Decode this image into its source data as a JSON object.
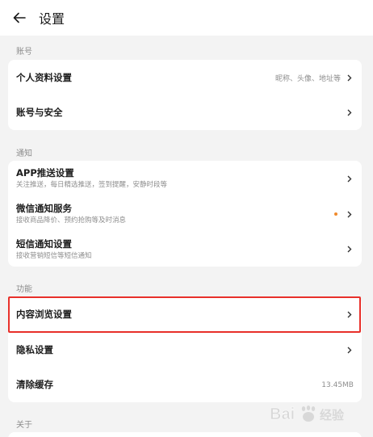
{
  "header": {
    "title": "设置"
  },
  "sections": {
    "account": {
      "label": "账号",
      "rows": [
        {
          "title": "个人资料设置",
          "hint": "昵称、头像、地址等"
        },
        {
          "title": "账号与安全"
        }
      ]
    },
    "notify": {
      "label": "通知",
      "rows": [
        {
          "title": "APP推送设置",
          "sub": "关注推送，每日精选推送，签到提醒，安静时段等"
        },
        {
          "title": "微信通知服务",
          "sub": "接收商品降价、预约抢购等及时消息"
        },
        {
          "title": "短信通知设置",
          "sub": "接收营销短信等短信通知"
        }
      ]
    },
    "feature": {
      "label": "功能",
      "rows": [
        {
          "title": "内容浏览设置"
        },
        {
          "title": "隐私设置"
        },
        {
          "title": "清除缓存",
          "value": "13.45MB"
        }
      ]
    },
    "about": {
      "label": "关于"
    }
  },
  "colors": {
    "accent_dot": "#f08a2c",
    "highlight": "#e8302a"
  }
}
